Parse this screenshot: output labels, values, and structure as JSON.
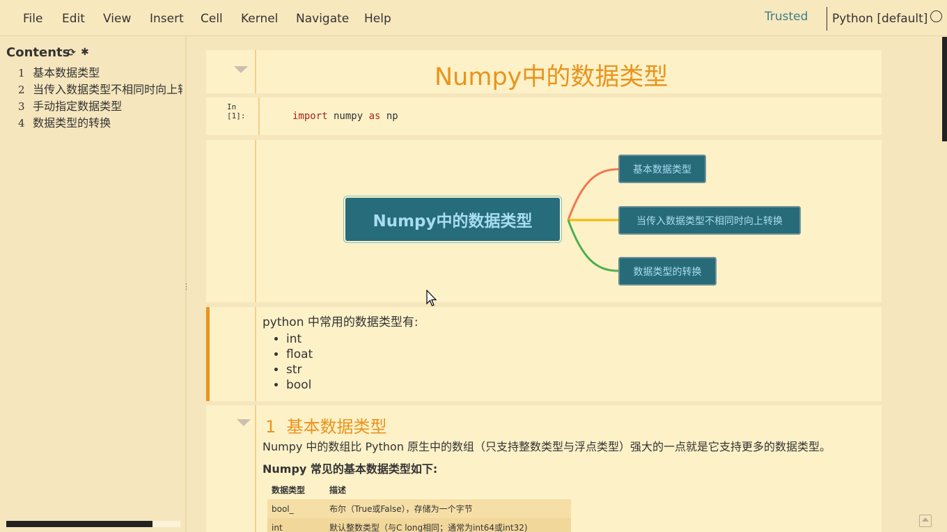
{
  "menubar": {
    "items": [
      "File",
      "Edit",
      "View",
      "Insert",
      "Cell",
      "Kernel",
      "Navigate",
      "Help"
    ],
    "trusted": "Trusted",
    "kernel": "Python [default]"
  },
  "toc": {
    "title": "Contents",
    "items": [
      {
        "num": "1",
        "label": "基本数据类型"
      },
      {
        "num": "2",
        "label": "当传入数据类型不相同时向上转换"
      },
      {
        "num": "3",
        "label": "手动指定数据类型"
      },
      {
        "num": "4",
        "label": "数据类型的转换"
      }
    ]
  },
  "cells": {
    "title": "Numpy中的数据类型",
    "code": {
      "prompt": "In [1]:",
      "kw_import": "import",
      "module": " numpy ",
      "kw_as": "as",
      "alias": " np"
    },
    "mindmap": {
      "root": "Numpy中的数据类型",
      "branches": [
        "基本数据类型",
        "当传入数据类型不相同时向上转换",
        "数据类型的转换"
      ],
      "colors": [
        "#f07850",
        "#f5b800",
        "#4caf50"
      ]
    },
    "list": {
      "intro": "python 中常用的数据类型有:",
      "items": [
        "int",
        "float",
        "str",
        "bool"
      ]
    },
    "section": {
      "num": "1",
      "title": "基本数据类型",
      "para": "Numpy 中的数组比 Python 原生中的数组（只支持整数类型与浮点类型）强大的一点就是它支持更多的数据类型。",
      "bold": "Numpy 常见的基本数据类型如下:",
      "table": {
        "headers": [
          "数据类型",
          "描述"
        ],
        "rows": [
          [
            "bool_",
            "布尔（True或False），存储为一个字节"
          ],
          [
            "int",
            "默认整数类型（与C long相同；通常为int64或int32)"
          ]
        ]
      }
    }
  }
}
